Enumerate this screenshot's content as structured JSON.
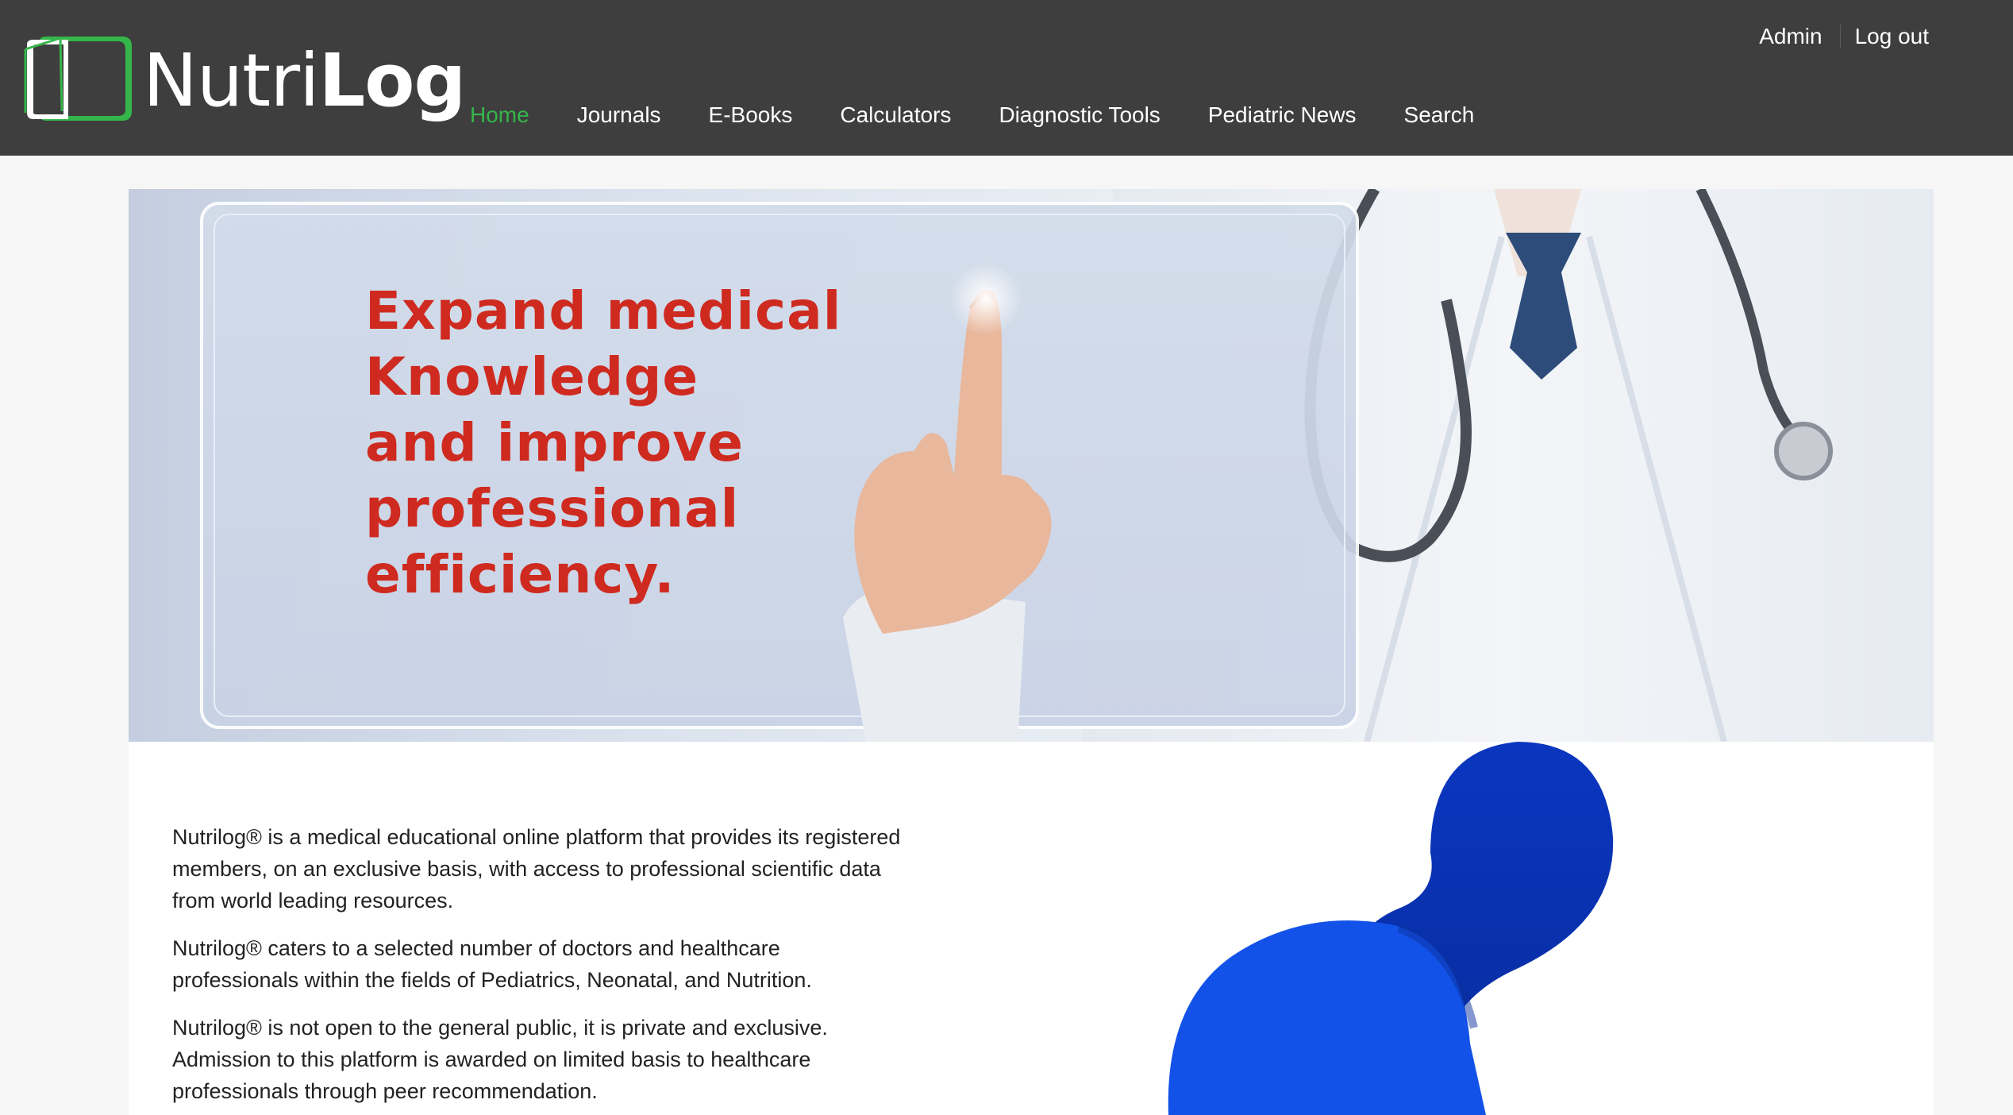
{
  "brand": {
    "name_light": "Nutri",
    "name_bold": "Log",
    "accent_color": "#35b64a",
    "icon": "logo-book-icon"
  },
  "top_links": [
    "Admin",
    "Log out"
  ],
  "nav": {
    "active": "Home",
    "items": [
      "Home",
      "Journals",
      "E-Books",
      "Calculators",
      "Diagnostic Tools",
      "Pediatric News",
      "Search"
    ]
  },
  "hero": {
    "lines": [
      "Expand medical",
      "Knowledge",
      "and improve",
      "professional",
      "efficiency."
    ],
    "text_color": "#cf2a1f"
  },
  "about": {
    "paragraphs": [
      "Nutrilog® is a medical educational online platform that provides its registered members, on an exclusive basis, with access to professional scientific data from world leading resources.",
      "Nutrilog® caters to a selected number of doctors and healthcare professionals within the fields of Pediatrics, Neonatal, and Nutrition.",
      "Nutrilog® is not open to the general public, it is private and exclusive. Admission to this platform is awarded on limited basis to healthcare professionals through peer recommendation."
    ]
  },
  "colors": {
    "header_bg": "#3e3e3e",
    "blob_dark": "#0a34b8",
    "blob_light": "#1352e8"
  }
}
